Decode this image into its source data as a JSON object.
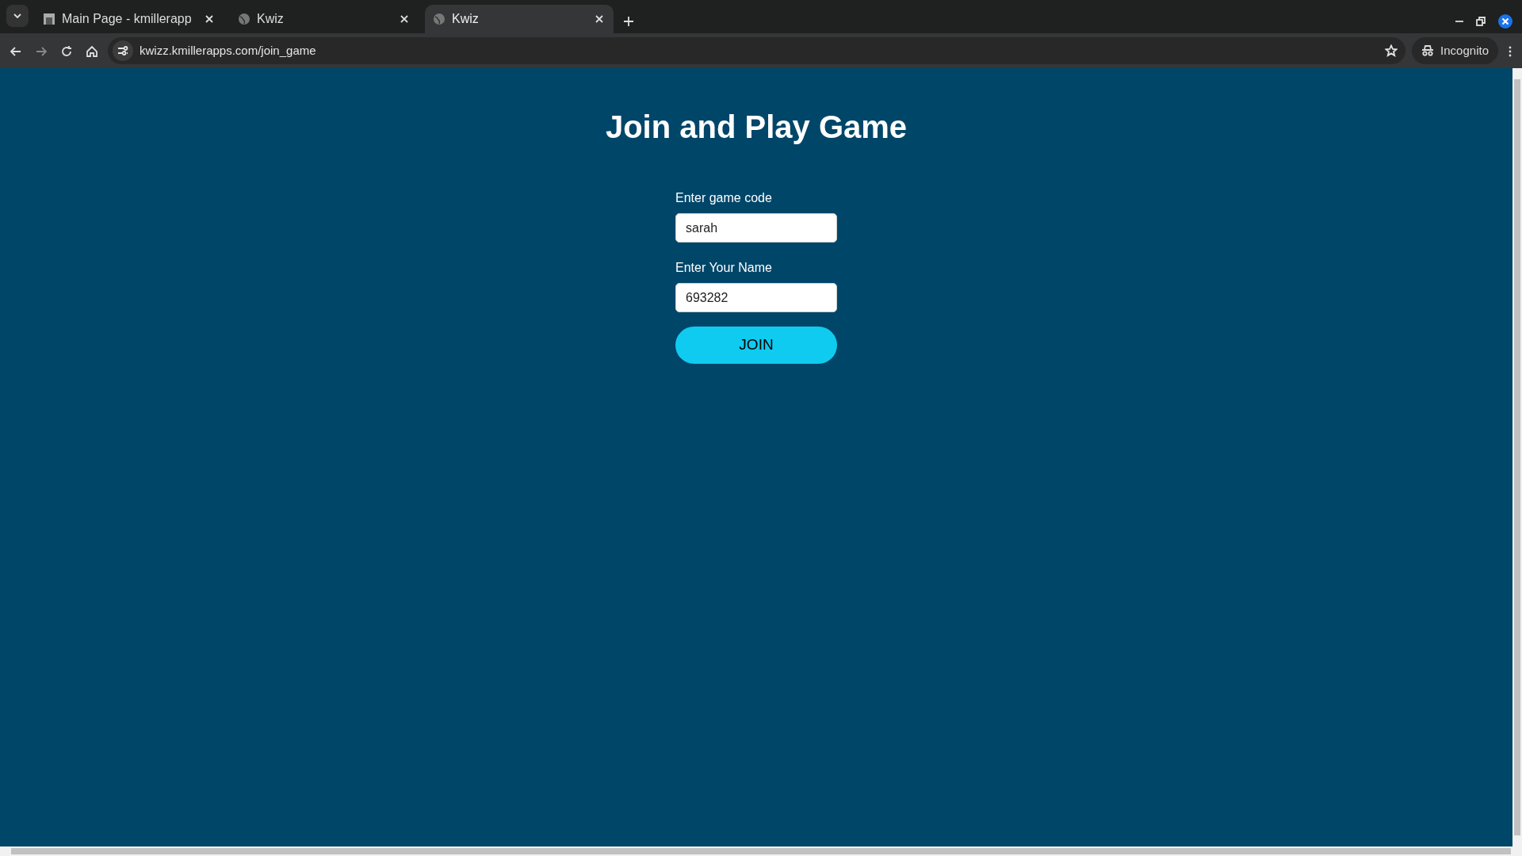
{
  "browser": {
    "tabs": [
      {
        "title": "Main Page - kmillerapp",
        "kind": "photo",
        "selected": false
      },
      {
        "title": "Kwiz",
        "kind": "globe",
        "selected": false
      },
      {
        "title": "Kwiz",
        "kind": "globe",
        "selected": true
      }
    ],
    "url": "kwizz.kmillerapps.com/join_game",
    "profile": "Incognito"
  },
  "page": {
    "heading": "Join and Play Game",
    "fields": [
      {
        "label": "Enter game code",
        "value": "sarah"
      },
      {
        "label": "Enter Your Name",
        "value": "693282"
      }
    ],
    "button": "JOIN"
  }
}
